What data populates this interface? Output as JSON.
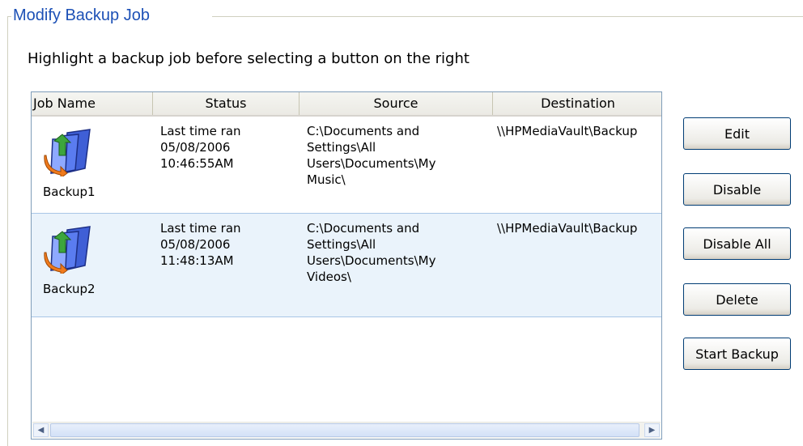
{
  "group_title": "Modify Backup Job",
  "instructions": "Highlight a backup job before selecting a button on the right",
  "columns": [
    "Job Name",
    "Status",
    "Source",
    "Destination"
  ],
  "jobs": [
    {
      "name": "Backup1",
      "status": "Last time ran\n05/08/2006\n10:46:55AM",
      "source": "C:\\Documents and\nSettings\\All\nUsers\\Documents\\My\nMusic\\",
      "destination": "\\\\HPMediaVault\\Backup"
    },
    {
      "name": "Backup2",
      "status": "Last time ran\n05/08/2006\n11:48:13AM",
      "source": "C:\\Documents and\nSettings\\All\nUsers\\Documents\\My\nVideos\\",
      "destination": "\\\\HPMediaVault\\Backup"
    }
  ],
  "buttons": {
    "edit": "Edit",
    "disable": "Disable",
    "disable_all": "Disable All",
    "delete": "Delete",
    "start_backup": "Start Backup"
  },
  "scrollbar": {
    "left_arrow": "◀",
    "right_arrow": "▶"
  }
}
